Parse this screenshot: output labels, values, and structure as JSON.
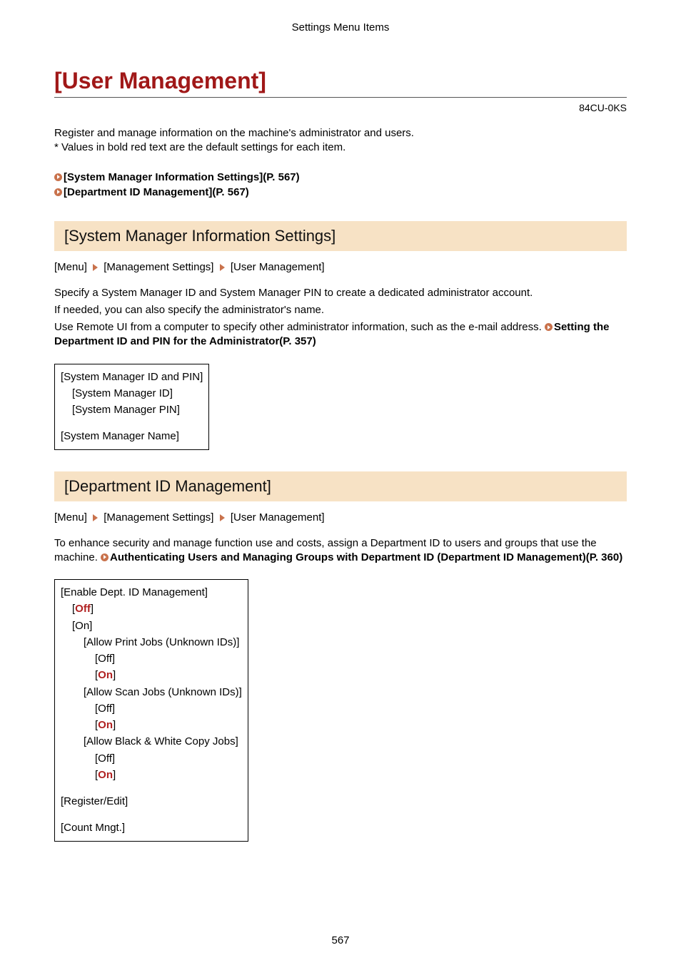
{
  "header": {
    "category": "Settings Menu Items"
  },
  "page": {
    "title": "[User Management]",
    "doc_code": "84CU-0KS",
    "number": "567"
  },
  "intro": {
    "line1": "Register and manage information on the machine's administrator and users.",
    "line2": "* Values in bold red text are the default settings for each item."
  },
  "toc": {
    "item1": "[System Manager Information Settings](P. 567)",
    "item2": "[Department ID Management](P. 567)"
  },
  "section1": {
    "heading": "[System Manager Information Settings]",
    "breadcrumb": {
      "p1": "[Menu]",
      "p2": "[Management Settings]",
      "p3": "[User Management]"
    },
    "desc": {
      "l1": "Specify a System Manager ID and System Manager PIN to create a dedicated administrator account.",
      "l2": "If needed, you can also specify the administrator's name.",
      "l3a": "Use Remote UI from a computer to specify other administrator information, such as the e-mail address. ",
      "xref": "Setting the Department ID and PIN for the Administrator(P. 357)"
    },
    "box": {
      "r1": "[System Manager ID and PIN]",
      "r2": "[System Manager ID]",
      "r3": "[System Manager PIN]",
      "r4": "[System Manager Name]"
    }
  },
  "section2": {
    "heading": "[Department ID Management]",
    "breadcrumb": {
      "p1": "[Menu]",
      "p2": "[Management Settings]",
      "p3": "[User Management]"
    },
    "desc": {
      "l1a": "To enhance security and manage function use and costs, assign a Department ID to users and groups that use the machine. ",
      "xref": "Authenticating Users and Managing Groups with Department ID (Department ID Management)(P. 360)"
    },
    "box": {
      "r1": "[Enable Dept. ID Management]",
      "r2_pre": "[",
      "r2_val": "Off",
      "r2_post": "]",
      "r3": "[On]",
      "r4": "[Allow Print Jobs (Unknown IDs)]",
      "r5": "[Off]",
      "r6_pre": "[",
      "r6_val": "On",
      "r6_post": "]",
      "r7": "[Allow Scan Jobs (Unknown IDs)]",
      "r8": "[Off]",
      "r9_pre": "[",
      "r9_val": "On",
      "r9_post": "]",
      "r10": "[Allow Black & White Copy Jobs]",
      "r11": "[Off]",
      "r12_pre": "[",
      "r12_val": "On",
      "r12_post": "]",
      "r13": "[Register/Edit]",
      "r14": "[Count Mngt.]"
    }
  }
}
